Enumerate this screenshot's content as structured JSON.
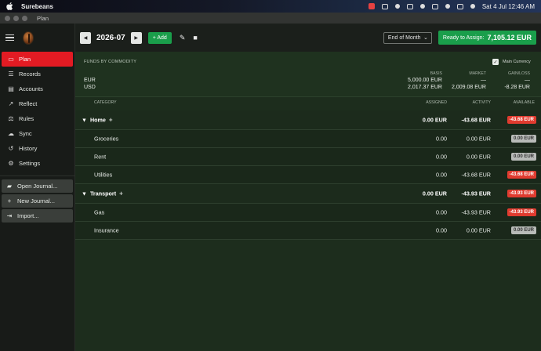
{
  "menubar": {
    "app_name": "Surebeans",
    "datetime": "Sat 4 Jul  12:46 AM"
  },
  "window": {
    "title": "Plan"
  },
  "sidebar": {
    "items": [
      {
        "label": "Plan",
        "icon": "plan-icon",
        "active": true
      },
      {
        "label": "Records",
        "icon": "list-icon"
      },
      {
        "label": "Accounts",
        "icon": "accounts-icon"
      },
      {
        "label": "Reflect",
        "icon": "chart-icon"
      },
      {
        "label": "Rules",
        "icon": "rules-icon"
      },
      {
        "label": "Sync",
        "icon": "cloud-icon"
      },
      {
        "label": "History",
        "icon": "history-icon"
      },
      {
        "label": "Settings",
        "icon": "gear-icon"
      }
    ],
    "actions": [
      {
        "label": "Open Journal...",
        "icon": "folder-icon"
      },
      {
        "label": "New Journal...",
        "icon": "plus-icon"
      },
      {
        "label": "Import...",
        "icon": "import-icon"
      }
    ]
  },
  "toolbar": {
    "month": "2026-07",
    "add_label": "+ Add",
    "period": "End of Month",
    "ready_label": "Ready to Assign:",
    "ready_amount": "7,105.12 EUR"
  },
  "funds": {
    "title": "FUNDS BY COMMODITY",
    "main_currency_label": "Main Currency",
    "main_currency_checked": true,
    "headers": {
      "basis": "BASIS",
      "market": "MARKET",
      "gain_loss": "GAIN/LOSS"
    },
    "rows": [
      {
        "commodity": "EUR",
        "basis": "5,000.00 EUR",
        "market": "—",
        "gain_loss": "—"
      },
      {
        "commodity": "USD",
        "basis": "2,017.37 EUR",
        "market": "2,009.08 EUR",
        "gain_loss": "-8.28 EUR"
      }
    ]
  },
  "table": {
    "headers": {
      "category": "CATEGORY",
      "assigned": "ASSIGNED",
      "activity": "ACTIVITY",
      "available": "AVAILABLE"
    },
    "groups": [
      {
        "name": "Home",
        "assigned": "0.00 EUR",
        "activity": "-43.68 EUR",
        "available": "-43.68 EUR",
        "status": "negative",
        "categories": [
          {
            "name": "Groceries",
            "assigned": "0.00",
            "activity": "0.00 EUR",
            "available": "0.00 EUR",
            "status": "zero"
          },
          {
            "name": "Rent",
            "assigned": "0.00",
            "activity": "0.00 EUR",
            "available": "0.00 EUR",
            "status": "zero"
          },
          {
            "name": "Utilities",
            "assigned": "0.00",
            "activity": "-43.68 EUR",
            "available": "-43.68 EUR",
            "status": "negative"
          }
        ]
      },
      {
        "name": "Transport",
        "assigned": "0.00 EUR",
        "activity": "-43.93 EUR",
        "available": "-43.93 EUR",
        "status": "negative",
        "categories": [
          {
            "name": "Gas",
            "assigned": "0.00",
            "activity": "-43.93 EUR",
            "available": "-43.93 EUR",
            "status": "negative"
          },
          {
            "name": "Insurance",
            "assigned": "0.00",
            "activity": "0.00 EUR",
            "available": "0.00 EUR",
            "status": "zero"
          }
        ]
      }
    ]
  }
}
